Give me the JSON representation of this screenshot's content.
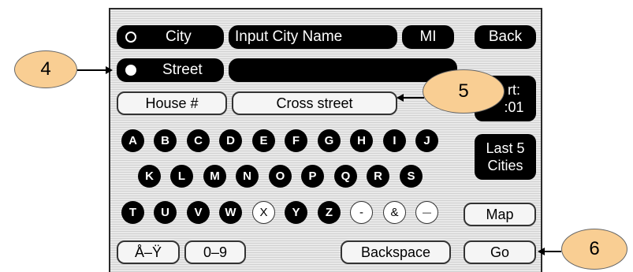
{
  "search_mode": {
    "city": {
      "label": "City",
      "selected": false
    },
    "street": {
      "label": "Street",
      "selected": true
    }
  },
  "city_input": {
    "value": "Input City Name"
  },
  "state_button": {
    "label": "MI"
  },
  "back_button": {
    "label": "Back"
  },
  "street_input": {
    "value": ""
  },
  "start_box": {
    "line1": "rt:",
    "line2": ":01"
  },
  "house_button": {
    "label": "House #"
  },
  "cross_street_button": {
    "label": "Cross street"
  },
  "last5_button": {
    "line1": "Last 5",
    "line2": "Cities"
  },
  "keys_row1": [
    "A",
    "B",
    "C",
    "D",
    "E",
    "F",
    "G",
    "H",
    "I",
    "J"
  ],
  "keys_row2": [
    "K",
    "L",
    "M",
    "N",
    "O",
    "P",
    "Q",
    "R",
    "S"
  ],
  "keys_row3": [
    "T",
    "U",
    "V",
    "W",
    "X",
    "Y",
    "Z",
    "-",
    "&",
    "—"
  ],
  "map_button": {
    "label": "Map"
  },
  "accents_button": {
    "label": "Å–Ÿ"
  },
  "numbers_button": {
    "label": "0–9"
  },
  "backspace_button": {
    "label": "Backspace"
  },
  "go_button": {
    "label": "Go"
  },
  "callouts": [
    "4",
    "5",
    "6"
  ]
}
